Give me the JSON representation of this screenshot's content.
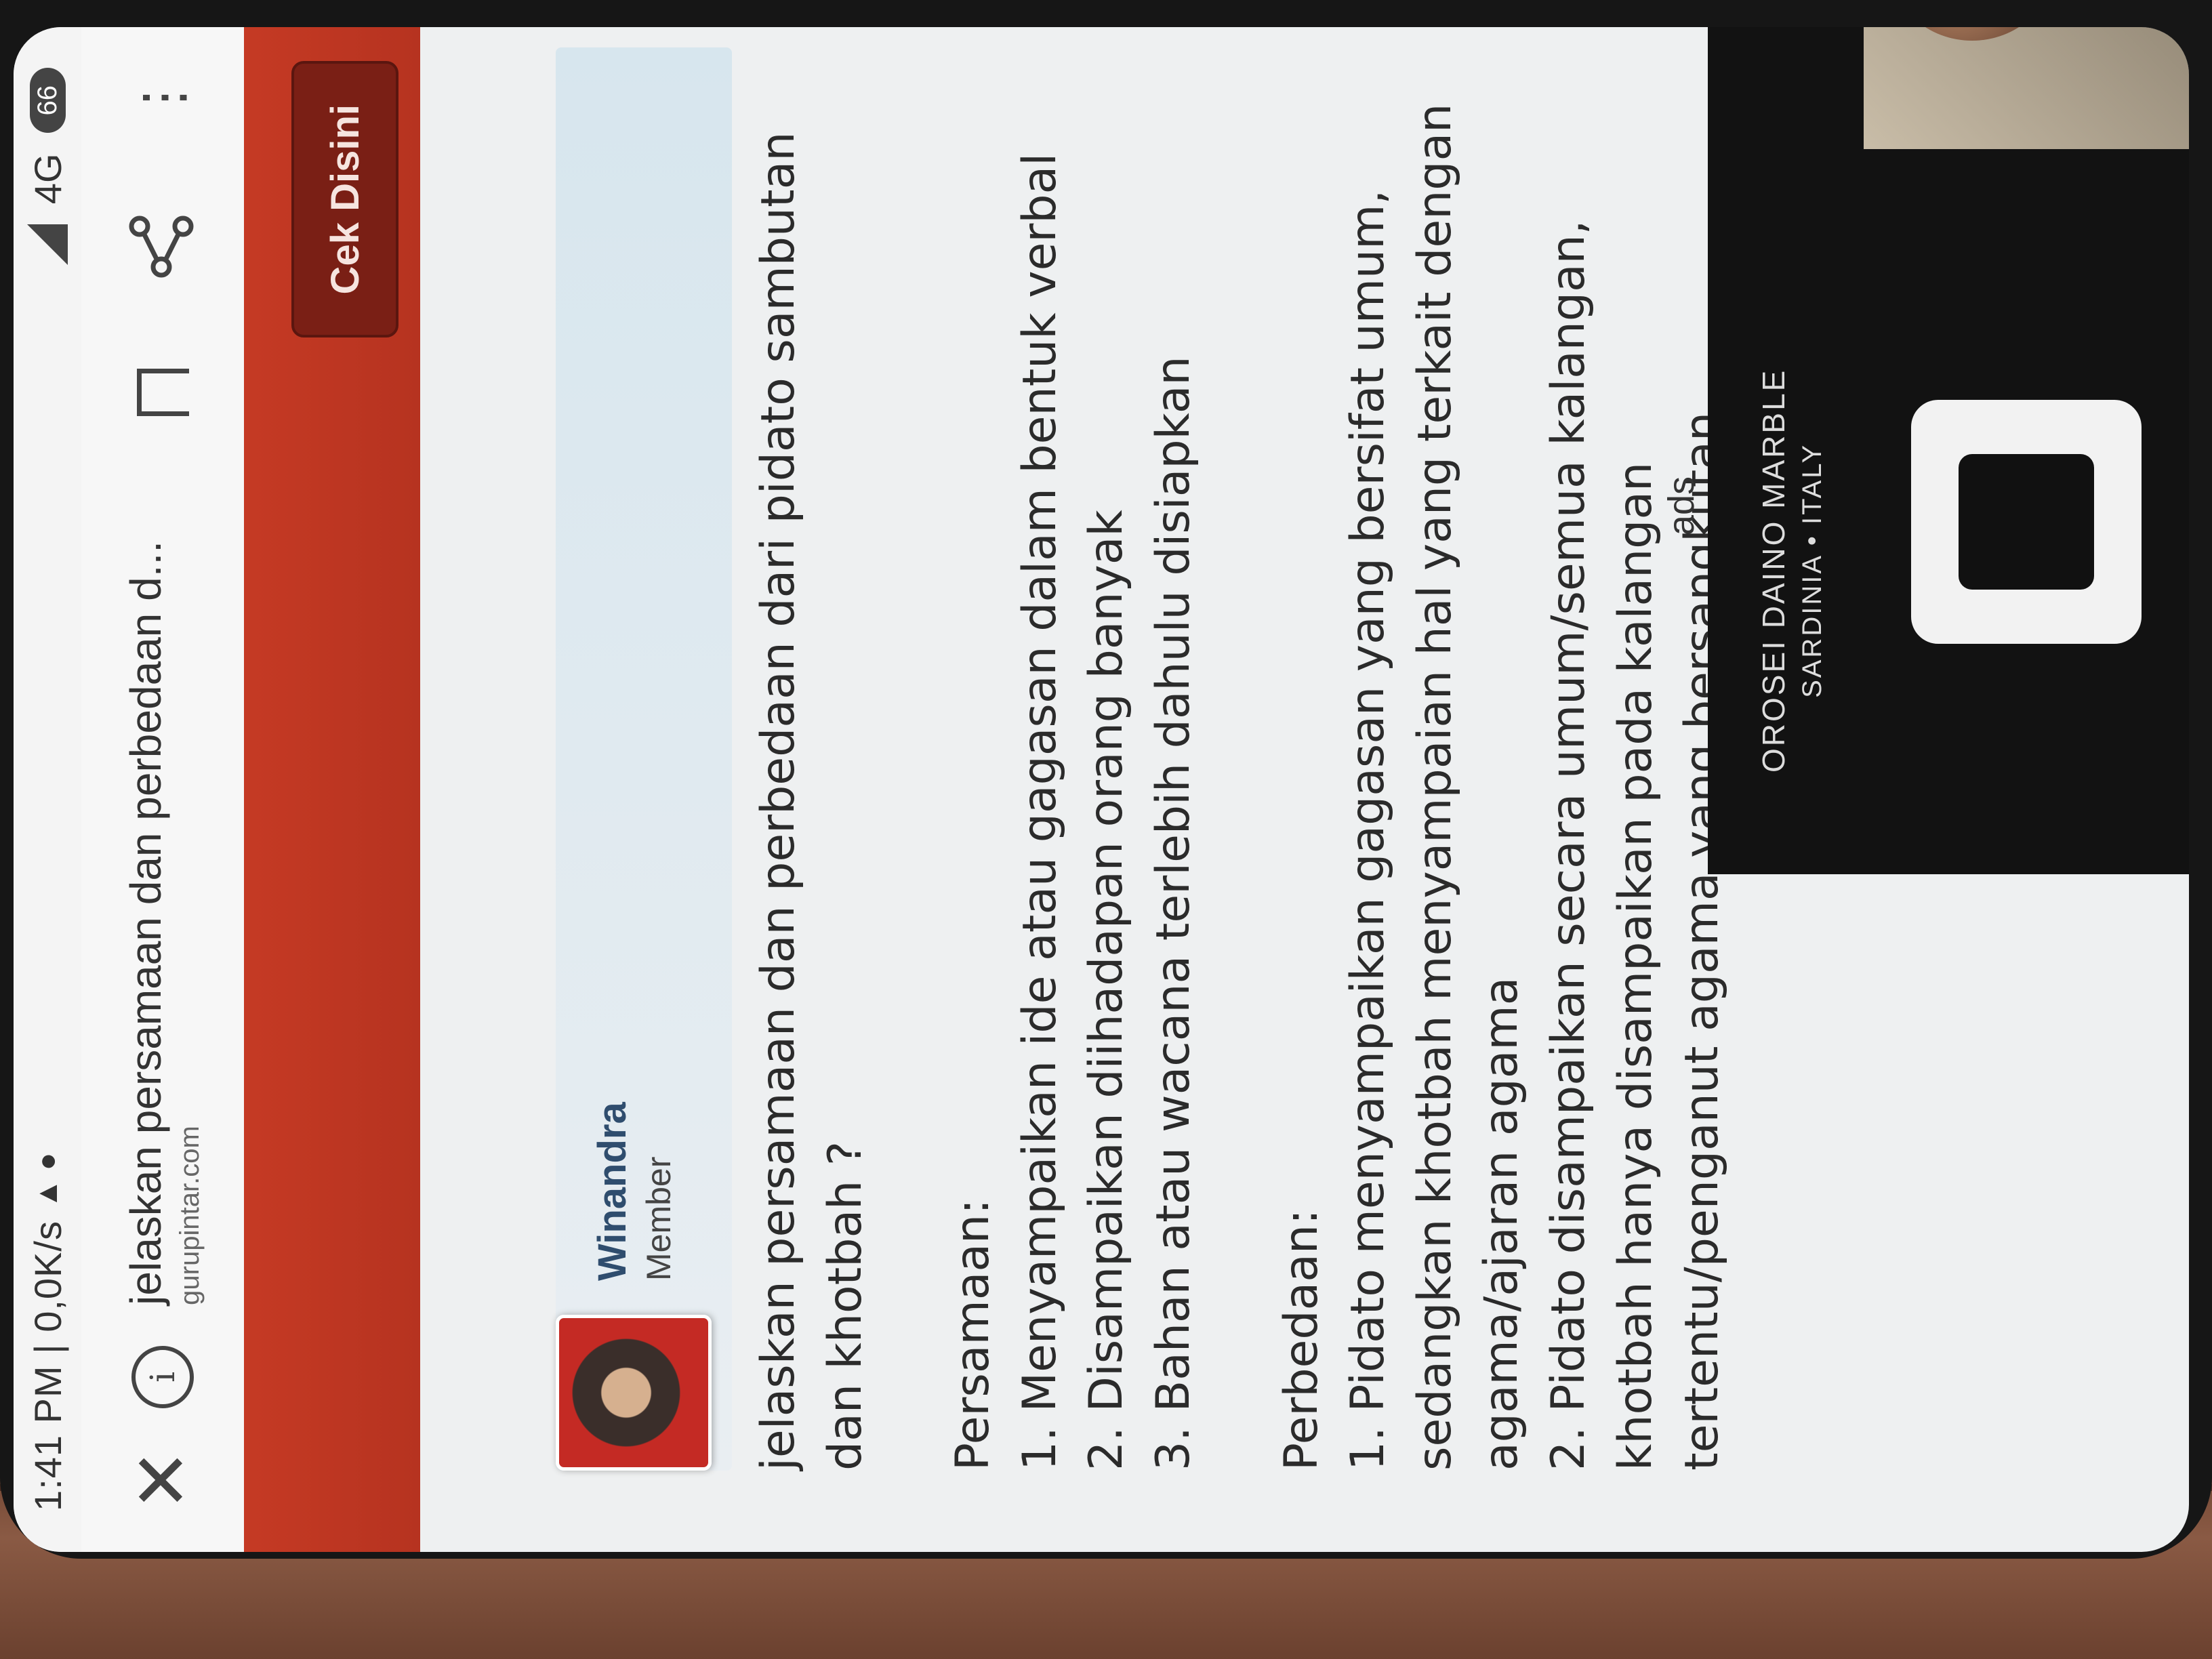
{
  "status_bar": {
    "time": "1:41 PM | 0,0K/s",
    "network": "4G",
    "battery": "66"
  },
  "url_bar": {
    "title": "jelaskan persamaan dan perbedaan d...",
    "domain": "gurupintar.com",
    "close_icon": "close-icon",
    "info_icon": "info-icon",
    "bookmark_icon": "bookmark-icon",
    "share_icon": "share-icon",
    "menu_icon": "more-vertical-icon"
  },
  "brand_bar": {
    "button_label": "Cek Disini",
    "color": "#c53a24"
  },
  "author": {
    "name": "Winandra",
    "role": "Member"
  },
  "article": {
    "question": "jelaskan persamaan dan perbedaan dari pidato sambutan dan khotbah ?",
    "similarities_heading": "Persamaan:",
    "similarities": [
      "1. Menyampaikan ide atau gagasan dalam bentuk verbal",
      "2. Disampaikan diihadapan orang banyak",
      "3. Bahan atau wacana terlebih dahulu disiapkan"
    ],
    "differences_heading": "Perbedaan:",
    "differences": [
      "1. Pidato menyampaikan gagasan yang bersifat umum, sedangkan khotbah menyampaian hal yang terkait dengan agama/ajaran agama",
      "2. Pidato disampaikan secara umum/semua kalangan, khotbah hanya disampaikan pada kalangan tertentu/penganut agama yang bersangkutan."
    ]
  },
  "ad": {
    "label": "ads",
    "brand_line1": "OROSEI DAINO MARBLE",
    "brand_line2": "SARDINIA • ITALY"
  }
}
